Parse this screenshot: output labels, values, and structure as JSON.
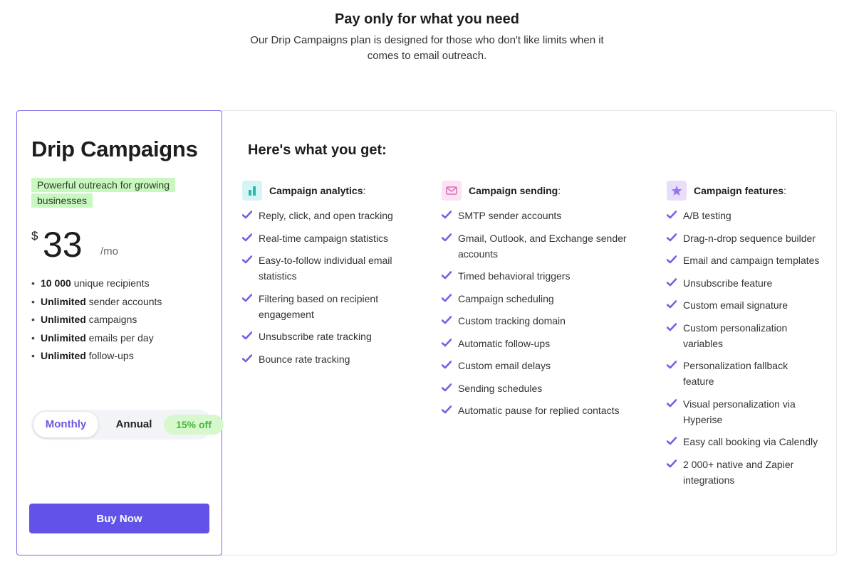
{
  "header": {
    "title": "Pay only for what you need",
    "subtitle": "Our Drip Campaigns plan is designed for those who don't like limits when it comes to email outreach."
  },
  "plan": {
    "name": "Drip Campaigns",
    "tagline": "Powerful outreach for growing businesses",
    "currency": "$",
    "price": "33",
    "period": "/mo",
    "limits": [
      {
        "bold": "10 000",
        "text": " unique recipients"
      },
      {
        "bold": "Unlimited",
        "text": " sender accounts"
      },
      {
        "bold": "Unlimited",
        "text": " campaigns"
      },
      {
        "bold": "Unlimited",
        "text": " emails per day"
      },
      {
        "bold": "Unlimited",
        "text": " follow-ups"
      }
    ],
    "billing": {
      "monthly_label": "Monthly",
      "annual_label": "Annual",
      "discount_label": "15% off",
      "selected": "Monthly"
    },
    "buy_label": "Buy Now"
  },
  "features": {
    "title": "Here's what you get:",
    "columns": [
      {
        "heading": "Campaign analytics",
        "icon": "bar-chart-icon",
        "items": [
          "Reply, click, and open tracking",
          "Real-time campaign statistics",
          "Easy-to-follow individual email statistics",
          "Filtering based on recipient engagement",
          "Unsubscribe rate tracking",
          "Bounce rate tracking"
        ]
      },
      {
        "heading": "Campaign sending",
        "icon": "envelope-icon",
        "items": [
          "SMTP sender accounts",
          "Gmail, Outlook, and Exchange sender accounts",
          "Timed behavioral triggers",
          "Campaign scheduling",
          "Custom tracking domain",
          "Automatic follow-ups",
          "Custom email delays",
          "Sending schedules",
          "Automatic pause for replied contacts"
        ]
      },
      {
        "heading": "Campaign features",
        "icon": "star-icon",
        "items": [
          "A/B testing",
          "Drag-n-drop sequence builder",
          "Email and campaign templates",
          "Unsubscribe feature",
          "Custom email signature",
          "Custom personalization variables",
          "Personalization fallback feature",
          "Visual personalization via Hyperise",
          "Easy call booking via Calendly",
          "2 000+ native and Zapier integrations"
        ]
      }
    ]
  },
  "colors": {
    "accent": "#6352e8",
    "check": "#7b5ce6",
    "tag_bg": "#c9f7c0",
    "discount_text": "#46b83a"
  }
}
